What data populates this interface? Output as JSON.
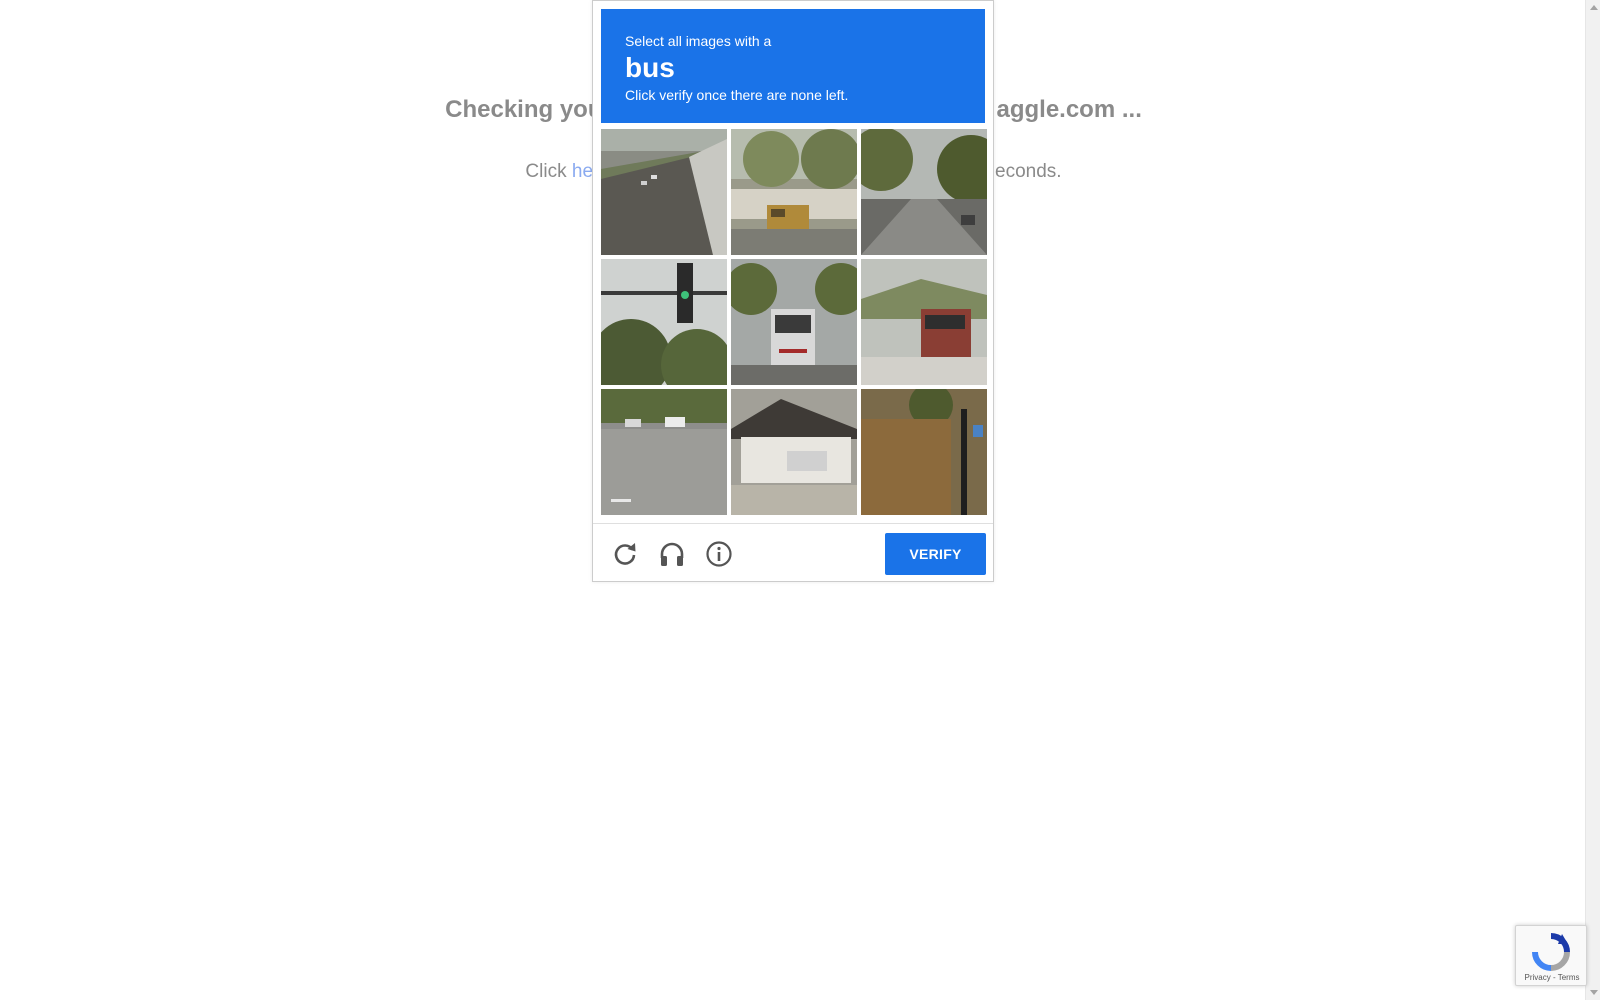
{
  "background": {
    "heading_left": "Checking you",
    "heading_right": "aggle.com ...",
    "sub_prefix": "Click ",
    "sub_link": "he",
    "sub_suffix": "econds."
  },
  "captcha": {
    "instruction_line1": "Select all images with a",
    "target_object": "bus",
    "instruction_line2": "Click verify once there are none left.",
    "tiles": [
      {
        "row": 1,
        "col": 1,
        "description": "highway-road"
      },
      {
        "row": 1,
        "col": 2,
        "description": "school-bus"
      },
      {
        "row": 1,
        "col": 3,
        "description": "tree-lined-road"
      },
      {
        "row": 2,
        "col": 1,
        "description": "traffic-light"
      },
      {
        "row": 2,
        "col": 2,
        "description": "city-bus-front"
      },
      {
        "row": 2,
        "col": 3,
        "description": "city-bus-back"
      },
      {
        "row": 3,
        "col": 1,
        "description": "street-with-cars"
      },
      {
        "row": 3,
        "col": 2,
        "description": "house-with-car"
      },
      {
        "row": 3,
        "col": 3,
        "description": "brick-building"
      }
    ],
    "footer": {
      "reload_icon": "reload-icon",
      "audio_icon": "headphones-icon",
      "info_icon": "info-icon",
      "verify_label": "VERIFY"
    },
    "colors": {
      "accent": "#1a73e8"
    }
  },
  "badge": {
    "terms_text": "Privacy - Terms"
  }
}
